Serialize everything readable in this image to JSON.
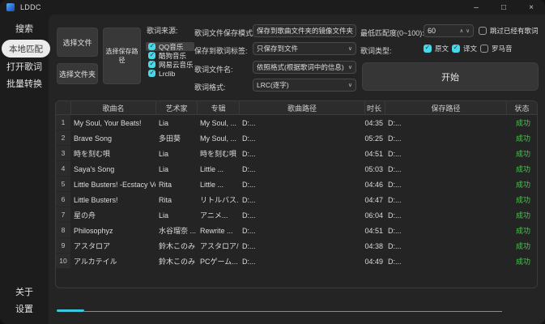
{
  "window": {
    "title": "LDDC"
  },
  "titlebar": {
    "minimize_icon": "–",
    "maximize_icon": "□",
    "close_icon": "×"
  },
  "icons": {
    "chevron_down": "∨",
    "chevron_up": "∧"
  },
  "colors": {
    "accent_cyan": "#49d8e8",
    "success_green": "#4fc553",
    "selected_pill": "#ebebeb",
    "logo_blue": "#2f6fd8"
  },
  "sidebar": {
    "items": [
      {
        "label": "搜索",
        "active": false
      },
      {
        "label": "本地匹配",
        "active": true
      },
      {
        "label": "打开歌词",
        "active": false
      },
      {
        "label": "批量转换",
        "active": false
      }
    ],
    "bottom_items": [
      {
        "label": "关于"
      },
      {
        "label": "设置"
      }
    ]
  },
  "controls": {
    "select_file": "选择文件",
    "select_folder": "选择文件夹",
    "select_save_path": "选择保存路径",
    "source_label": "歌词来源:",
    "sources": [
      {
        "label": "QQ音乐",
        "checked": true,
        "highlighted": true
      },
      {
        "label": "酷狗音乐",
        "checked": true,
        "highlighted": false
      },
      {
        "label": "网易云音乐",
        "checked": true,
        "highlighted": false
      },
      {
        "label": "Lrclib",
        "checked": true,
        "highlighted": false
      }
    ],
    "form": [
      {
        "label": "歌词文件保存模式:",
        "value": "保存到歌曲文件夹的镜像文件夹"
      },
      {
        "label": "保存到歌词标签:",
        "value": "只保存到文件"
      },
      {
        "label": "歌词文件名:",
        "value": "依照格式(根据歌词中的信息)"
      },
      {
        "label": "歌词格式:",
        "value": "LRC(逐字)"
      }
    ],
    "match_label": "最低匹配度(0~100):",
    "match_value": "60",
    "skip_label": "跳过已经有歌词",
    "skip_checked": false,
    "type_label": "歌词类型:",
    "types": [
      {
        "label": "原文",
        "checked": true
      },
      {
        "label": "译文",
        "checked": true
      },
      {
        "label": "罗马音",
        "checked": false
      }
    ],
    "start_label": "开始"
  },
  "table": {
    "headers": [
      "歌曲名",
      "艺术家",
      "专辑",
      "歌曲路径",
      "时长",
      "保存路径",
      "状态"
    ],
    "rows": [
      {
        "num": "1",
        "name": "My Soul, Your Beats!",
        "artist": "Lia",
        "album": "My Soul, ...",
        "path": "D:...",
        "duration": "04:35",
        "save": "D:...",
        "status": "成功"
      },
      {
        "num": "2",
        "name": "Brave Song",
        "artist": "多田葵",
        "album": "My Soul, ...",
        "path": "D:...",
        "duration": "05:25",
        "save": "D:...",
        "status": "成功"
      },
      {
        "num": "3",
        "name": "時を刻む唄",
        "artist": "Lia",
        "album": "時を刻む唄 ...",
        "path": "D:...",
        "duration": "04:51",
        "save": "D:...",
        "status": "成功"
      },
      {
        "num": "4",
        "name": "Saya's Song",
        "artist": "Lia",
        "album": "Little ...",
        "path": "D:...",
        "duration": "05:03",
        "save": "D:...",
        "status": "成功"
      },
      {
        "num": "5",
        "name": "Little Busters! -Ecstacy Ver.-",
        "artist": "Rita",
        "album": "Little ...",
        "path": "D:...",
        "duration": "04:46",
        "save": "D:...",
        "status": "成功"
      },
      {
        "num": "6",
        "name": "Little Busters!",
        "artist": "Rita",
        "album": "リトルバス...",
        "path": "D:...",
        "duration": "04:47",
        "save": "D:...",
        "status": "成功"
      },
      {
        "num": "7",
        "name": "星の舟",
        "artist": "Lia",
        "album": "アニメ...",
        "path": "D:...",
        "duration": "06:04",
        "save": "D:...",
        "status": "成功"
      },
      {
        "num": "8",
        "name": "Philosophyz",
        "artist": "水谷瑠奈 ...",
        "album": "Rewrite ...",
        "path": "D:...",
        "duration": "04:51",
        "save": "D:...",
        "status": "成功"
      },
      {
        "num": "9",
        "name": "アスタロア",
        "artist": "鈴木このみ",
        "album": "アスタロア/...",
        "path": "D:...",
        "duration": "04:38",
        "save": "D:...",
        "status": "成功"
      },
      {
        "num": "10",
        "name": "アルカテイル",
        "artist": "鈴木このみ",
        "album": "PCゲーム...",
        "path": "D:...",
        "duration": "04:49",
        "save": "D:...",
        "status": "成功"
      }
    ]
  },
  "progress": {
    "fraction": 0.06
  }
}
